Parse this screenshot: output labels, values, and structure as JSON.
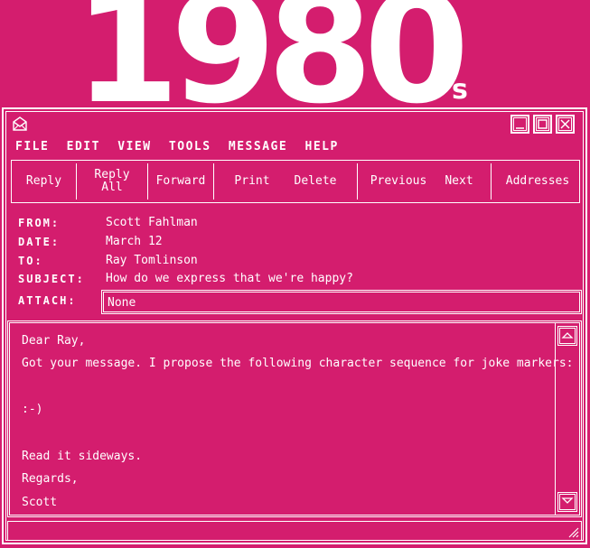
{
  "banner": {
    "year": "1980",
    "suffix": "s"
  },
  "window": {
    "icons": {
      "app": "envelope-icon",
      "minimize": "minimize-icon",
      "maximize": "maximize-icon",
      "close": "close-icon"
    }
  },
  "menu": [
    "FILE",
    "EDIT",
    "VIEW",
    "TOOLS",
    "MESSAGE",
    "HELP"
  ],
  "toolbar": {
    "reply": "Reply",
    "reply_all_1": "Reply",
    "reply_all_2": "All",
    "forward": "Forward",
    "print": "Print",
    "delete": "Delete",
    "previous": "Previous",
    "next": "Next",
    "addresses": "Addresses"
  },
  "header": {
    "from_label": "FROM:",
    "from": "Scott Fahlman",
    "date_label": "DATE:",
    "date": "March 12",
    "to_label": "TO:",
    "to": "Ray Tomlinson",
    "subject_label": "SUBJECT:",
    "subject": "How do we express that we're happy?",
    "attach_label": "ATTACH:",
    "attach": "None"
  },
  "body": {
    "greeting": "Dear Ray,",
    "line1": "Got your message. I propose the following character sequence for joke markers:",
    "emoticon": ":-)",
    "line2": "Read it sideways.",
    "closing": "Regards,",
    "signature": "Scott"
  },
  "colors": {
    "background": "#d41d6e",
    "foreground": "#ffffff"
  }
}
